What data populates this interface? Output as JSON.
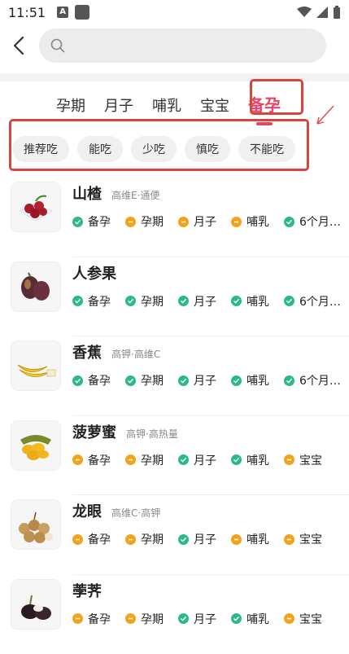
{
  "status_bar": {
    "time": "11:51",
    "notif_icon_label": "A"
  },
  "search": {
    "placeholder": ""
  },
  "tabs": [
    {
      "label": "孕期",
      "active": false
    },
    {
      "label": "月子",
      "active": false
    },
    {
      "label": "哺乳",
      "active": false
    },
    {
      "label": "宝宝",
      "active": false
    },
    {
      "label": "备孕",
      "active": true
    }
  ],
  "filters": [
    "推荐吃",
    "能吃",
    "少吃",
    "慎吃",
    "不能吃"
  ],
  "colors": {
    "accent": "#e8446a",
    "ok": "#2bb985",
    "warn": "#f4a21c",
    "highlight_box": "#d8453c"
  },
  "foods": [
    {
      "name": "山楂",
      "tags": "高维E·通便",
      "statuses": [
        {
          "label": "备孕",
          "level": "ok"
        },
        {
          "label": "孕期",
          "level": "warn"
        },
        {
          "label": "月子",
          "level": "warn"
        },
        {
          "label": "哺乳",
          "level": "warn"
        },
        {
          "label": "6个月…",
          "level": "ok"
        }
      ]
    },
    {
      "name": "人参果",
      "tags": "",
      "statuses": [
        {
          "label": "备孕",
          "level": "ok"
        },
        {
          "label": "孕期",
          "level": "ok"
        },
        {
          "label": "月子",
          "level": "ok"
        },
        {
          "label": "哺乳",
          "level": "ok"
        },
        {
          "label": "6个月…",
          "level": "ok"
        }
      ]
    },
    {
      "name": "香蕉",
      "tags": "高钾·高维C",
      "statuses": [
        {
          "label": "备孕",
          "level": "ok"
        },
        {
          "label": "孕期",
          "level": "ok"
        },
        {
          "label": "月子",
          "level": "ok"
        },
        {
          "label": "哺乳",
          "level": "ok"
        },
        {
          "label": "6个月…",
          "level": "ok"
        }
      ]
    },
    {
      "name": "菠萝蜜",
      "tags": "高钾·高热量",
      "statuses": [
        {
          "label": "备孕",
          "level": "warn"
        },
        {
          "label": "孕期",
          "level": "warn"
        },
        {
          "label": "月子",
          "level": "ok"
        },
        {
          "label": "哺乳",
          "level": "ok"
        },
        {
          "label": "宝宝",
          "level": "warn"
        }
      ]
    },
    {
      "name": "龙眼",
      "tags": "高维C·高钾",
      "statuses": [
        {
          "label": "备孕",
          "level": "warn"
        },
        {
          "label": "孕期",
          "level": "warn"
        },
        {
          "label": "月子",
          "level": "ok"
        },
        {
          "label": "哺乳",
          "level": "warn"
        },
        {
          "label": "宝宝",
          "level": "warn"
        }
      ]
    },
    {
      "name": "荸荠",
      "tags": "",
      "statuses": [
        {
          "label": "备孕",
          "level": "warn"
        },
        {
          "label": "孕期",
          "level": "warn"
        },
        {
          "label": "月子",
          "level": "ok"
        },
        {
          "label": "哺乳",
          "level": "ok"
        },
        {
          "label": "宝宝",
          "level": "warn"
        }
      ]
    }
  ]
}
